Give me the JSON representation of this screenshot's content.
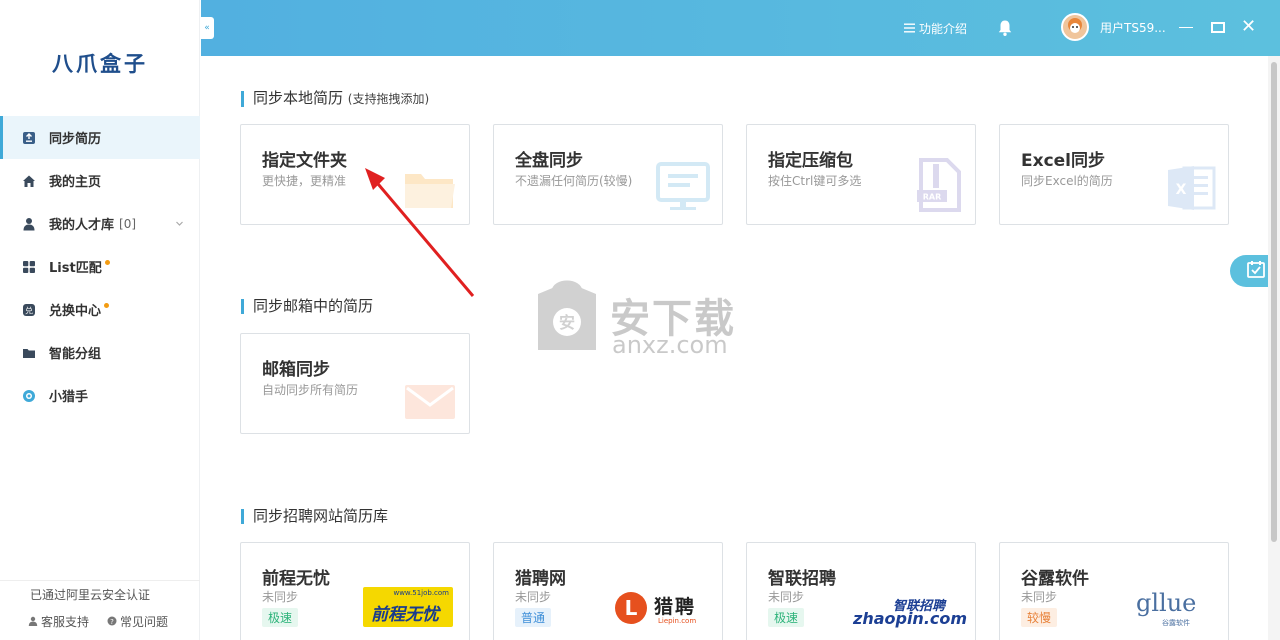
{
  "app": {
    "logo": "八爪盒子"
  },
  "sidebar": {
    "items": [
      {
        "label": "同步简历",
        "icon": "upload-doc-icon",
        "active": true
      },
      {
        "label": "我的主页",
        "icon": "home-icon"
      },
      {
        "label": "我的人才库",
        "count": "[0]",
        "icon": "person-icon",
        "expandable": true
      },
      {
        "label": "List匹配",
        "icon": "grid-icon",
        "dot": true
      },
      {
        "label": "兑换中心",
        "icon": "exchange-icon",
        "dot": true
      },
      {
        "label": "智能分组",
        "icon": "folder-icon"
      },
      {
        "label": "小猎手",
        "icon": "hunter-icon"
      }
    ],
    "certification": "已通过阿里云安全认证",
    "support": "客服支持",
    "faq": "常见问题"
  },
  "header": {
    "intro": "功能介绍",
    "username": "用户TS59..."
  },
  "sections": {
    "local": {
      "title": "同步本地简历",
      "subtitle": "(支持拖拽添加)"
    },
    "email": {
      "title": "同步邮箱中的简历"
    },
    "sites": {
      "title": "同步招聘网站简历库"
    }
  },
  "local_cards": [
    {
      "title": "指定文件夹",
      "desc": "更快捷，更精准",
      "icon": "folder-icon"
    },
    {
      "title": "全盘同步",
      "desc": "不遗漏任何简历(较慢)",
      "icon": "monitor-icon"
    },
    {
      "title": "指定压缩包",
      "desc": "按住Ctrl键可多选",
      "icon": "rar-icon"
    },
    {
      "title": "Excel同步",
      "desc": "同步Excel的简历",
      "icon": "excel-icon"
    }
  ],
  "email_cards": [
    {
      "title": "邮箱同步",
      "desc": "自动同步所有简历",
      "icon": "mail-icon"
    }
  ],
  "site_cards": [
    {
      "title": "前程无忧",
      "status": "未同步",
      "tag": "极速",
      "logo": "51job",
      "logo_text": "前程无忧",
      "logo_url": "www.51job.com",
      "tag_color": "#e6f7ef",
      "tag_text_color": "#2db37a"
    },
    {
      "title": "猎聘网",
      "status": "未同步",
      "tag": "普通",
      "logo": "liepin",
      "logo_text": "猎聘",
      "logo_url": "Liepin.com",
      "tag_color": "#e6f1fb",
      "tag_text_color": "#3f8fd8"
    },
    {
      "title": "智联招聘",
      "status": "未同步",
      "tag": "极速",
      "logo": "zhaopin",
      "logo_text": "智联招聘",
      "logo_url": "zhaopin.com",
      "tag_color": "#e6f7ef",
      "tag_text_color": "#2db37a"
    },
    {
      "title": "谷露软件",
      "status": "未同步",
      "tag": "较慢",
      "logo": "gllue",
      "logo_text": "gllue",
      "logo_sub": "谷露软件",
      "tag_color": "#fdeee2",
      "tag_text_color": "#e8823a"
    }
  ],
  "watermark": {
    "text": "安下载",
    "url": "anxz.com"
  },
  "colors": {
    "accent": "#3fa9d8",
    "header": "#52b0e0"
  }
}
